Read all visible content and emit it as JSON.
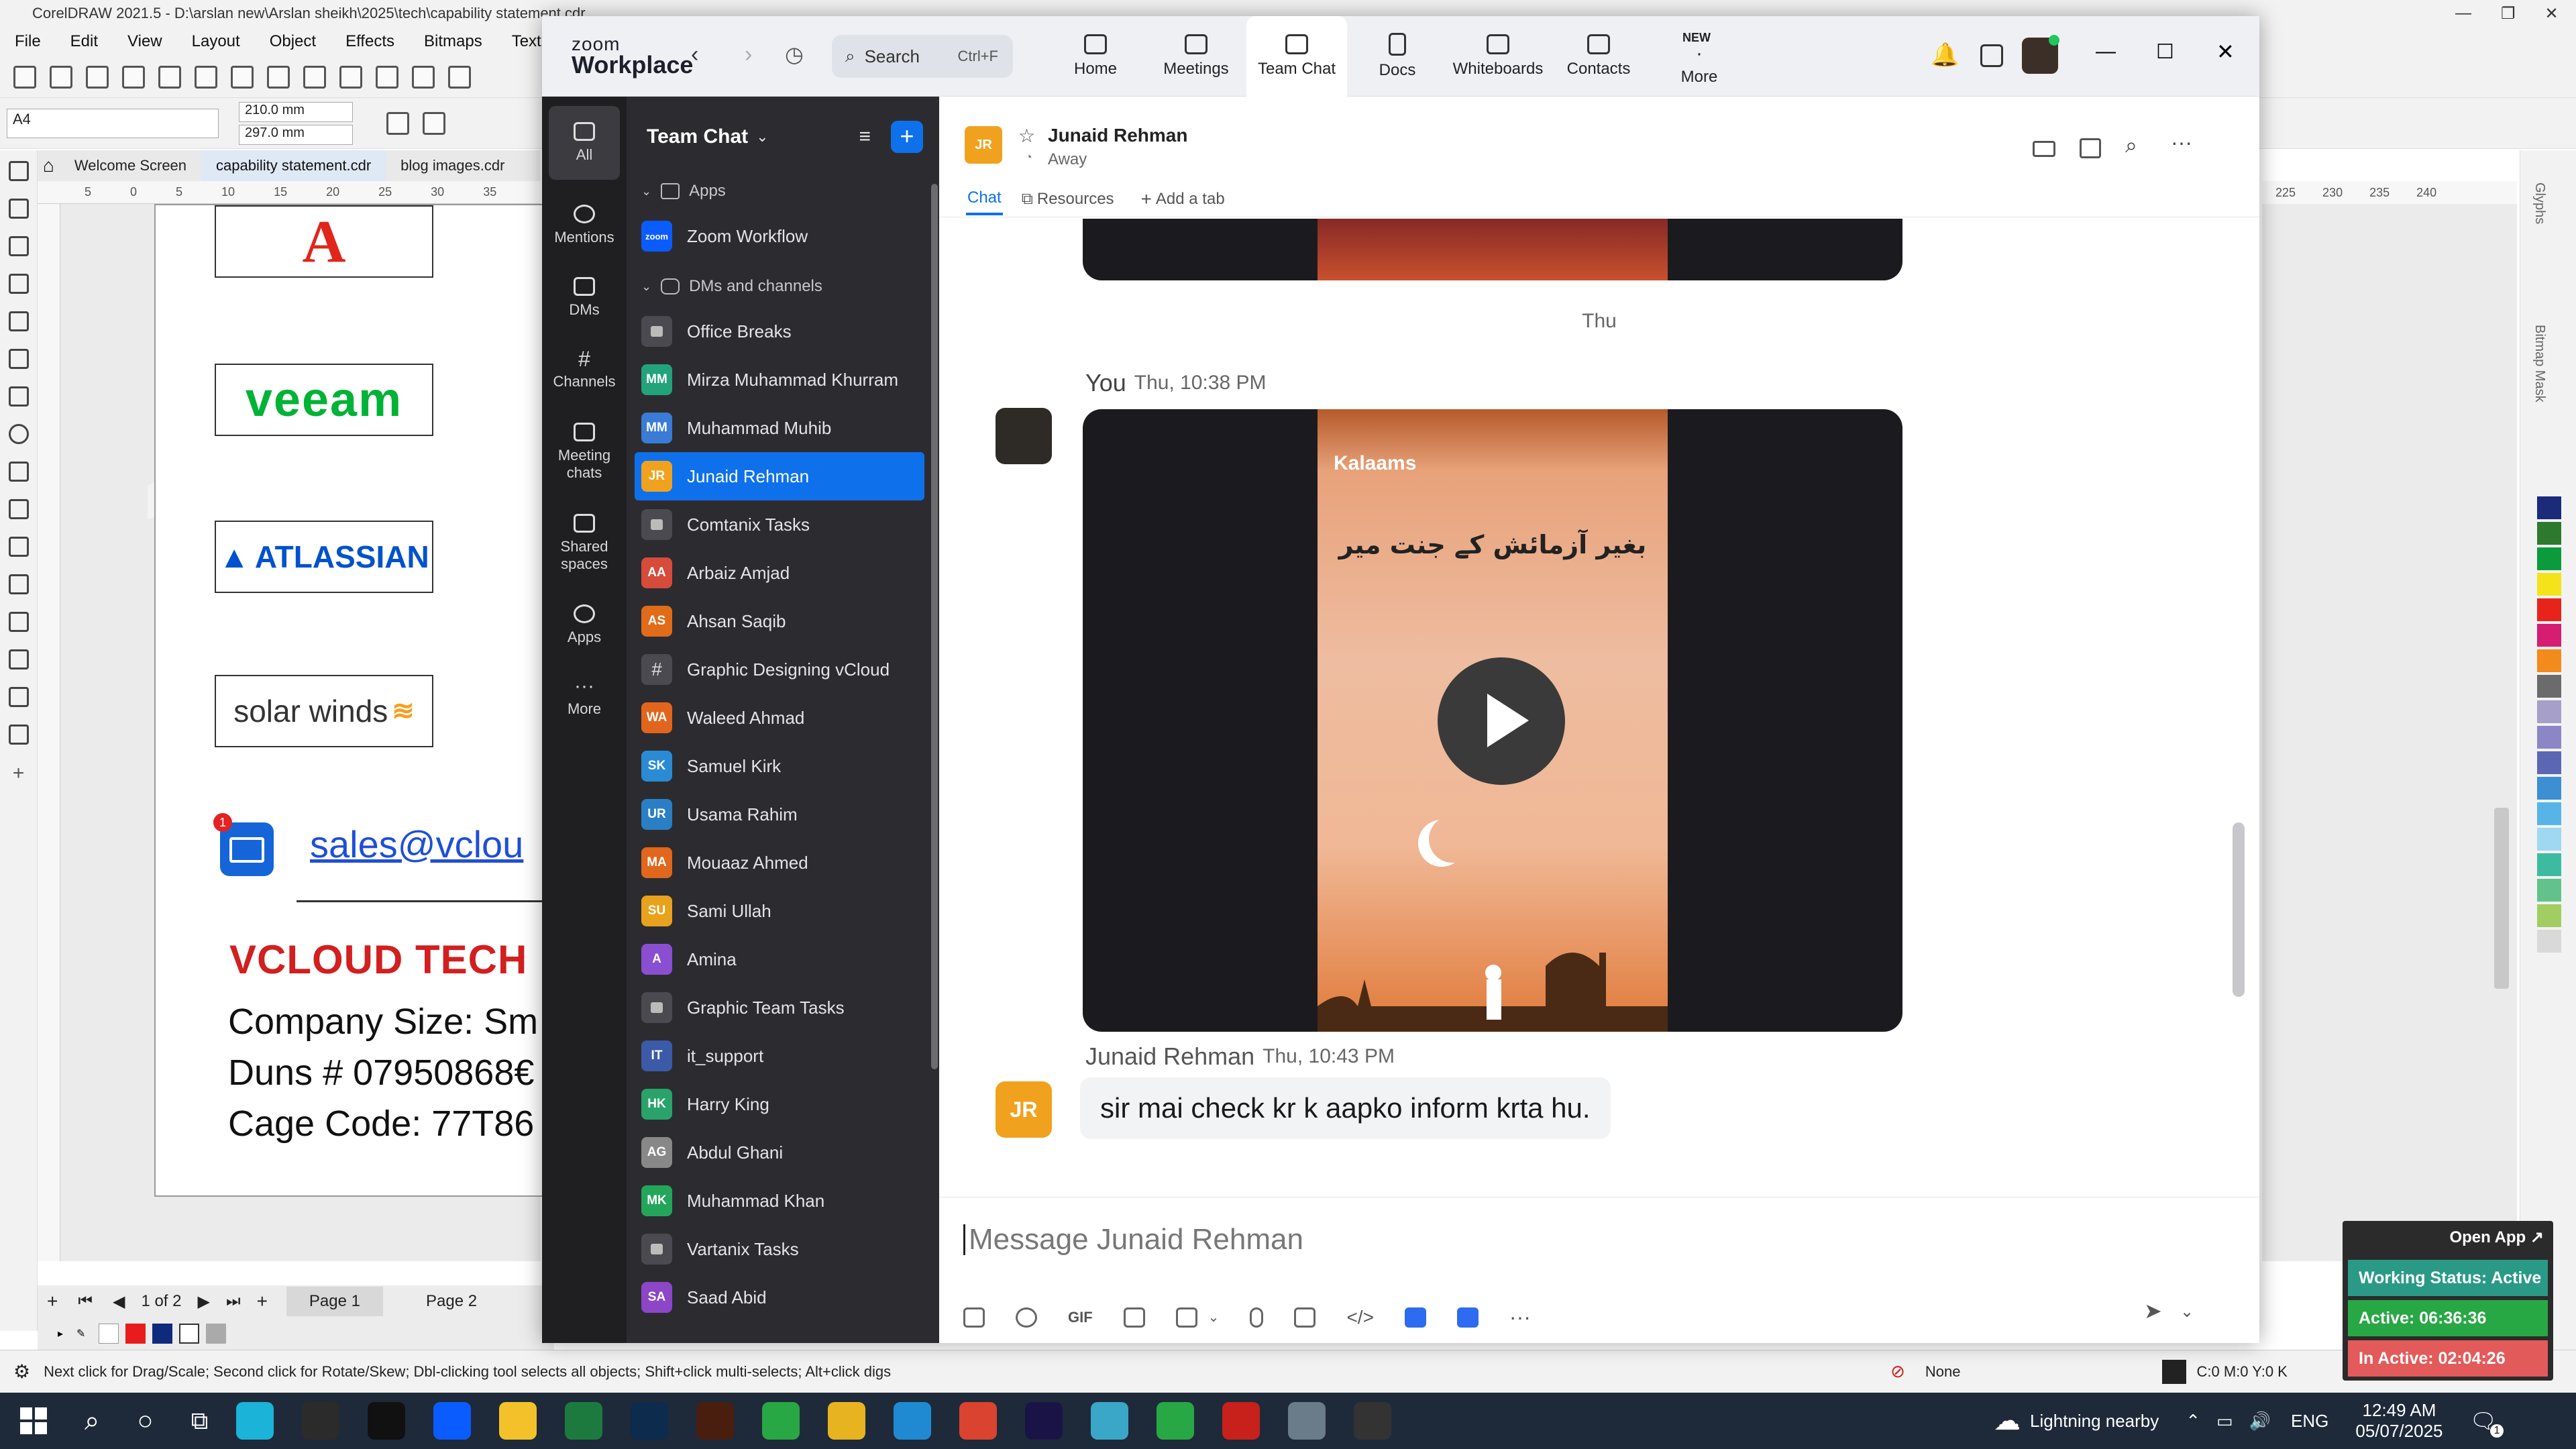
{
  "coreldraw": {
    "title": "CorelDRAW 2021.5 - D:\\arslan new\\Arslan sheikh\\2025\\tech\\capability statement.cdr",
    "menu": [
      "File",
      "Edit",
      "View",
      "Layout",
      "Object",
      "Effects",
      "Bitmaps",
      "Text"
    ],
    "page_size": "A4",
    "width_value": "210.0 mm",
    "height_value": "297.0 mm",
    "tabs": [
      "Welcome Screen",
      "capability statement.cdr",
      "blog images.cdr"
    ],
    "ruler_marks": [
      "5",
      "0",
      "5",
      "10",
      "15",
      "20",
      "25",
      "30",
      "35"
    ],
    "logos": {
      "adobe": "A",
      "veeam": "veeam",
      "atlassian": "ATLASSIAN",
      "solarwinds": "solar winds"
    },
    "email": "sales@vclou",
    "email_badge": "1",
    "company_title": "VCLOUD TECH",
    "company_size": "Company Size: Sm",
    "duns": "Duns # 07950868€",
    "cage": "Cage Code: 77T86",
    "page_count": "1 of 2",
    "page_tabs": [
      "Page 1",
      "Page 2"
    ],
    "status_hint": "Next click for Drag/Scale; Second click for Rotate/Skew; Dbl-clicking tool selects all objects; Shift+click multi-selects; Alt+click digs",
    "fill_none": "None",
    "color_readout": "C:0 M:0 Y:0 K",
    "right_ruler": [
      "225",
      "230",
      "235",
      "240"
    ],
    "right_ruler_unit": "millimeters",
    "dock_labels": [
      "Glyphs",
      "Bitmap Mask"
    ],
    "palette": [
      "#1c2a7a",
      "#2d7a2f",
      "#0c9b3c",
      "#f4e21b",
      "#e8231b",
      "#d61d72",
      "#f28a1c",
      "#6b6b6b",
      "#a59fc9",
      "#8b86c5",
      "#5c67b3",
      "#3b8fd2",
      "#56b5e6",
      "#9fd8f0",
      "#3dbba0",
      "#63c28c",
      "#a2cd62",
      "#d9d9d9"
    ]
  },
  "zoom": {
    "brand_top": "zoom",
    "brand_bottom": "Workplace",
    "search_label": "Search",
    "search_shortcut": "Ctrl+F",
    "nav": [
      {
        "label": "Home",
        "icon": "home-icon"
      },
      {
        "label": "Meetings",
        "icon": "video-camera-icon"
      },
      {
        "label": "Team Chat",
        "icon": "chat-bubbles-icon"
      },
      {
        "label": "Docs",
        "icon": "document-icon"
      },
      {
        "label": "Whiteboards",
        "icon": "whiteboard-icon"
      },
      {
        "label": "Contacts",
        "icon": "contacts-icon"
      },
      {
        "label": "More",
        "icon": "more-icon",
        "badge": "NEW"
      }
    ],
    "rail": [
      {
        "label": "All",
        "icon": "chat-icon"
      },
      {
        "label": "Mentions",
        "icon": "at-icon"
      },
      {
        "label": "DMs",
        "icon": "people-icon"
      },
      {
        "label": "Channels",
        "icon": "hash-icon"
      },
      {
        "label": "Meeting chats",
        "icon": "calendar-icon"
      },
      {
        "label": "Shared spaces",
        "icon": "shared-spaces-icon"
      },
      {
        "label": "Apps",
        "icon": "apps-icon"
      },
      {
        "label": "More",
        "icon": "ellipsis-icon"
      }
    ],
    "sidebar_title": "Team Chat",
    "apps_section": "Apps",
    "apps": [
      {
        "name": "Zoom Workflow",
        "initials": "zoom",
        "color": "#0b5cff"
      }
    ],
    "dm_section": "DMs and channels",
    "contacts": [
      {
        "name": "Office Breaks",
        "kind": "lock"
      },
      {
        "name": "Mirza Muhammad Khurram",
        "initials": "MM",
        "color": "#23a37a"
      },
      {
        "name": "Muhammad Muhib",
        "initials": "MM",
        "color": "#3a7bd5"
      },
      {
        "name": "Junaid Rehman",
        "initials": "JR",
        "color": "#f0a21e",
        "active": true
      },
      {
        "name": "Comtanix Tasks",
        "kind": "lock"
      },
      {
        "name": "Arbaiz Amjad",
        "initials": "AA",
        "color": "#d64b3a"
      },
      {
        "name": "Ahsan Saqib",
        "initials": "AS",
        "color": "#e06c1a"
      },
      {
        "name": "Graphic Designing vCloud",
        "kind": "hash"
      },
      {
        "name": "Waleed Ahmad",
        "initials": "WA",
        "color": "#e2651d"
      },
      {
        "name": "Samuel Kirk",
        "initials": "SK",
        "color": "#2a8bd4"
      },
      {
        "name": "Usama Rahim",
        "initials": "UR",
        "color": "#2a7fc4"
      },
      {
        "name": "Mouaaz Ahmed",
        "initials": "MA",
        "color": "#e0671b"
      },
      {
        "name": "Sami Ullah",
        "initials": "SU",
        "color": "#e8a21d"
      },
      {
        "name": "Amina",
        "initials": "A",
        "color": "#8a4fd1"
      },
      {
        "name": "Graphic Team Tasks",
        "kind": "lock"
      },
      {
        "name": "it_support",
        "initials": "IT",
        "color": "#3b5ba8"
      },
      {
        "name": "Harry King",
        "initials": "HK",
        "color": "#29a36a"
      },
      {
        "name": "Abdul Ghani",
        "initials": "AG",
        "color": "#888888"
      },
      {
        "name": "Muhammad Khan",
        "initials": "MK",
        "color": "#23a65a"
      },
      {
        "name": "Vartanix Tasks",
        "kind": "lock"
      },
      {
        "name": "Saad Abid",
        "initials": "SA",
        "color": "#8d46c7"
      }
    ],
    "chat": {
      "contact_initials": "JR",
      "contact_name": "Junaid Rehman",
      "status": "Away",
      "tabs": [
        "Chat",
        "Resources"
      ],
      "add_tab": "Add a tab",
      "date_divider": "Thu",
      "my_sender": "You",
      "my_time": "Thu, 10:38 PM",
      "video_brand": "Kalaams",
      "video_caption": "بغیر آزمائش کے جنت میر",
      "reply_sender": "Junaid Rehman",
      "reply_time": "Thu, 10:43 PM",
      "reply_text": "sir mai check kr k aapko inform krta hu.",
      "input_placeholder": "Message Junaid Rehman",
      "gif_label": "GIF"
    }
  },
  "work_status": {
    "open_app": "Open App ↗",
    "working": "Working Status: Active",
    "active": "Active: 06:36:36",
    "inactive": "In Active: 02:04:26"
  },
  "taskbar": {
    "apps": [
      {
        "name": "edge",
        "color": "#1bb3d8"
      },
      {
        "name": "pen",
        "color": "#2b2b2b"
      },
      {
        "name": "terminal",
        "color": "#111111"
      },
      {
        "name": "zoom",
        "color": "#0b5cff"
      },
      {
        "name": "explorer",
        "color": "#f3c22b"
      },
      {
        "name": "excel",
        "color": "#1d7a3e"
      },
      {
        "name": "photoshop",
        "color": "#0c2b4d"
      },
      {
        "name": "illustrator",
        "color": "#4a1e0e"
      },
      {
        "name": "coreldraw-green",
        "color": "#28a745"
      },
      {
        "name": "chrome",
        "color": "#e8b321"
      },
      {
        "name": "vscode",
        "color": "#1f8ad2"
      },
      {
        "name": "chrome-2",
        "color": "#d9432f"
      },
      {
        "name": "premiere",
        "color": "#1a1446"
      },
      {
        "name": "app-hex",
        "color": "#3aa6c8"
      },
      {
        "name": "coreldraw",
        "color": "#28a745"
      },
      {
        "name": "acrobat",
        "color": "#c8201b"
      },
      {
        "name": "calculator",
        "color": "#6a7b8a"
      },
      {
        "name": "media-player",
        "color": "#333333"
      }
    ],
    "weather": "Lightning nearby",
    "lang": "ENG",
    "time": "12:49 AM",
    "date": "05/07/2025",
    "notification_count": "1"
  }
}
